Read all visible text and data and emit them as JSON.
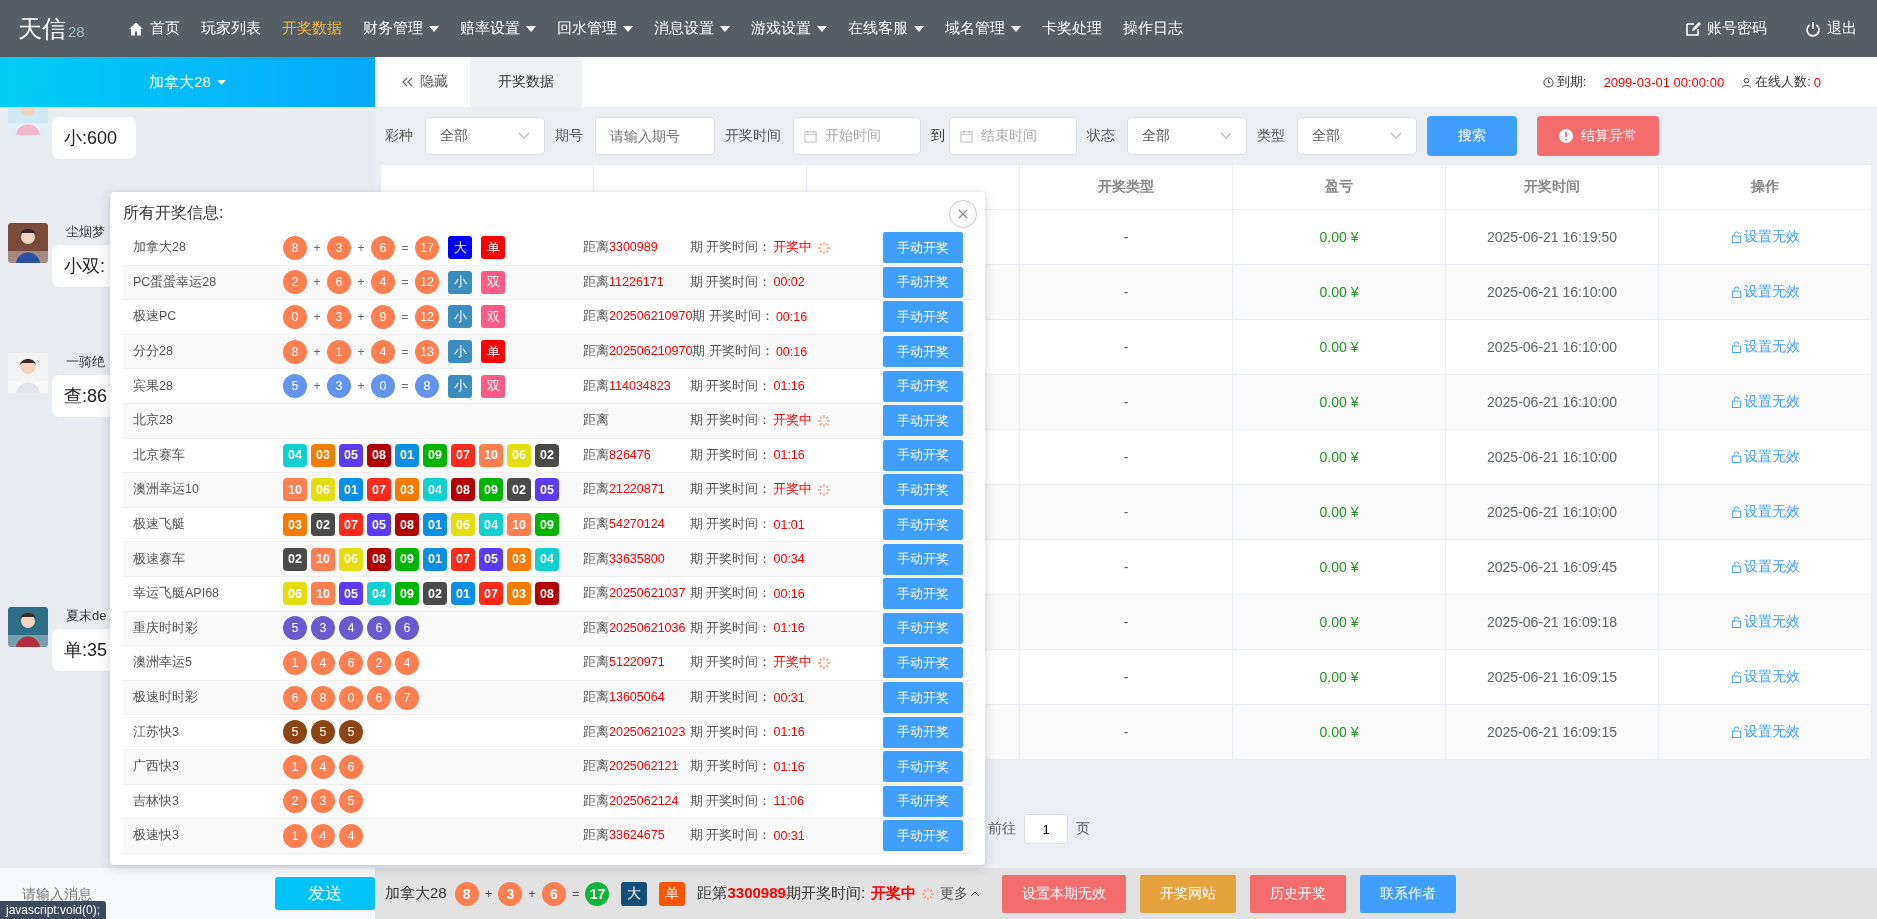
{
  "nav": {
    "logo": "天信",
    "logo_sub": "28",
    "items": [
      {
        "label": "首页",
        "selected": false,
        "dropdown": false
      },
      {
        "label": "玩家列表",
        "selected": false,
        "dropdown": false
      },
      {
        "label": "开奖数据",
        "selected": true,
        "dropdown": false
      },
      {
        "label": "财务管理",
        "selected": false,
        "dropdown": true
      },
      {
        "label": "赔率设置",
        "selected": false,
        "dropdown": true
      },
      {
        "label": "回水管理",
        "selected": false,
        "dropdown": true
      },
      {
        "label": "消息设置",
        "selected": false,
        "dropdown": true
      },
      {
        "label": "游戏设置",
        "selected": false,
        "dropdown": true
      },
      {
        "label": "在线客服",
        "selected": false,
        "dropdown": true
      },
      {
        "label": "域名管理",
        "selected": false,
        "dropdown": true
      },
      {
        "label": "卡奖处理",
        "selected": false,
        "dropdown": false
      },
      {
        "label": "操作日志",
        "selected": false,
        "dropdown": false
      }
    ],
    "account": "账号密码",
    "logout": "退出"
  },
  "lottery_switch": {
    "label": "加拿大28"
  },
  "tabs": {
    "hide": "隐藏",
    "items": [
      {
        "label": "开奖数据",
        "selected": true
      }
    ]
  },
  "expiry": {
    "label": "到期:",
    "value": "2099-03-01 00:00:00"
  },
  "online": {
    "label": "在线人数:",
    "value": "0"
  },
  "filters": [
    {
      "kind": "select",
      "label": "彩种",
      "value": "全部"
    },
    {
      "kind": "input",
      "label": "期号",
      "placeholder": "请输入期号"
    },
    {
      "kind": "daterange",
      "label": "开奖时间",
      "start_placeholder": "开始时间",
      "separator": "到",
      "end_placeholder": "结束时间"
    },
    {
      "kind": "select",
      "label": "状态",
      "value": "全部"
    },
    {
      "kind": "select",
      "label": "类型",
      "value": "全部"
    }
  ],
  "search_button": "搜索",
  "error_button": "结算异常",
  "table": {
    "visible_columns": [
      "开奖类型",
      "盈亏",
      "开奖时间",
      "操作"
    ],
    "rows": [
      {
        "type": "-",
        "profit": "0.00 ¥",
        "time": "2025-06-21 16:19:50",
        "action": "设置无效"
      },
      {
        "type": "-",
        "profit": "0.00 ¥",
        "time": "2025-06-21 16:10:00",
        "action": "设置无效"
      },
      {
        "type": "-",
        "profit": "0.00 ¥",
        "time": "2025-06-21 16:10:00",
        "action": "设置无效"
      },
      {
        "type": "-",
        "profit": "0.00 ¥",
        "time": "2025-06-21 16:10:00",
        "action": "设置无效"
      },
      {
        "type": "-",
        "profit": "0.00 ¥",
        "time": "2025-06-21 16:10:00",
        "action": "设置无效"
      },
      {
        "type": "-",
        "profit": "0.00 ¥",
        "time": "2025-06-21 16:10:00",
        "action": "设置无效"
      },
      {
        "type": "-",
        "profit": "0.00 ¥",
        "time": "2025-06-21 16:09:45",
        "action": "设置无效"
      },
      {
        "type": "-",
        "profit": "0.00 ¥",
        "time": "2025-06-21 16:09:18",
        "action": "设置无效"
      },
      {
        "type": "-",
        "profit": "0.00 ¥",
        "time": "2025-06-21 16:09:15",
        "action": "设置无效"
      },
      {
        "type": "-",
        "profit": "0.00 ¥",
        "time": "2025-06-21 16:09:15",
        "action": "设置无效"
      }
    ]
  },
  "pagination": {
    "goto": "前往",
    "page": "1",
    "unit": "页"
  },
  "chat": {
    "messages": [
      {
        "text": "小:600"
      },
      {
        "name": "尘烟梦",
        "text": "小双:"
      },
      {
        "name": "一骑绝",
        "text": "查:86"
      },
      {
        "name": "夏末de",
        "text": "单:35"
      }
    ],
    "input_placeholder": "请输入消息",
    "send": "发送"
  },
  "popup": {
    "title": "所有开奖信息:",
    "rows": [
      {
        "name": "加拿大28",
        "items": [
          {
            "kind": "ball",
            "text": "8",
            "color": "#ff7f50"
          },
          {
            "kind": "op",
            "text": "+"
          },
          {
            "kind": "ball",
            "text": "3",
            "color": "#ff7f50"
          },
          {
            "kind": "op",
            "text": "+"
          },
          {
            "kind": "ball",
            "text": "6",
            "color": "#ff7f50"
          },
          {
            "kind": "op",
            "text": "="
          },
          {
            "kind": "ball",
            "text": "17",
            "color": "#ff7f50"
          },
          {
            "kind": "tag",
            "text": "大",
            "color": "#0000ff"
          },
          {
            "kind": "tag",
            "text": "单",
            "color": "#ff0000"
          }
        ],
        "distance": "距离",
        "issue": "3300989",
        "time_label": "期 开奖时间：",
        "time": "开奖中",
        "spinner": true,
        "button": "手动开奖"
      },
      {
        "name": "PC蛋蛋幸运28",
        "items": [
          {
            "kind": "ball",
            "text": "2",
            "color": "#ff7f50"
          },
          {
            "kind": "op",
            "text": "+"
          },
          {
            "kind": "ball",
            "text": "6",
            "color": "#ff7f50"
          },
          {
            "kind": "op",
            "text": "+"
          },
          {
            "kind": "ball",
            "text": "4",
            "color": "#ff7f50"
          },
          {
            "kind": "op",
            "text": "="
          },
          {
            "kind": "ball",
            "text": "12",
            "color": "#ff7f50"
          },
          {
            "kind": "tag",
            "text": "小",
            "color": "#3b8dbd"
          },
          {
            "kind": "tag",
            "text": "双",
            "color": "#fd5a86"
          }
        ],
        "distance": "距离",
        "issue": "11226171",
        "time_label": "期 开奖时间：",
        "time": "00:02",
        "spinner": false,
        "button": "手动开奖"
      },
      {
        "name": "极速PC",
        "items": [
          {
            "kind": "ball",
            "text": "0",
            "color": "#ff7f50"
          },
          {
            "kind": "op",
            "text": "+"
          },
          {
            "kind": "ball",
            "text": "3",
            "color": "#ff7f50"
          },
          {
            "kind": "op",
            "text": "+"
          },
          {
            "kind": "ball",
            "text": "9",
            "color": "#ff7f50"
          },
          {
            "kind": "op",
            "text": "="
          },
          {
            "kind": "ball",
            "text": "12",
            "color": "#ff7f50"
          },
          {
            "kind": "tag",
            "text": "小",
            "color": "#3b8dbd"
          },
          {
            "kind": "tag",
            "text": "双",
            "color": "#fd5a86"
          }
        ],
        "distance": "距离",
        "issue": "202506210970",
        "time_label": "期 开奖时间：",
        "time": "00:16",
        "spinner": false,
        "button": "手动开奖"
      },
      {
        "name": "分分28",
        "items": [
          {
            "kind": "ball",
            "text": "8",
            "color": "#ff7f50"
          },
          {
            "kind": "op",
            "text": "+"
          },
          {
            "kind": "ball",
            "text": "1",
            "color": "#ff7f50"
          },
          {
            "kind": "op",
            "text": "+"
          },
          {
            "kind": "ball",
            "text": "4",
            "color": "#ff7f50"
          },
          {
            "kind": "op",
            "text": "="
          },
          {
            "kind": "ball",
            "text": "13",
            "color": "#ff7f50"
          },
          {
            "kind": "tag",
            "text": "小",
            "color": "#3b8dbd"
          },
          {
            "kind": "tag",
            "text": "单",
            "color": "#ff0000"
          }
        ],
        "distance": "距离",
        "issue": "202506210970",
        "time_label": "期 开奖时间：",
        "time": "00:16",
        "spinner": false,
        "button": "手动开奖"
      },
      {
        "name": "宾果28",
        "items": [
          {
            "kind": "ball",
            "text": "5",
            "color": "#6495ed"
          },
          {
            "kind": "op",
            "text": "+"
          },
          {
            "kind": "ball",
            "text": "3",
            "color": "#6495ed"
          },
          {
            "kind": "op",
            "text": "+"
          },
          {
            "kind": "ball",
            "text": "0",
            "color": "#6495ed"
          },
          {
            "kind": "op",
            "text": "="
          },
          {
            "kind": "ball",
            "text": "8",
            "color": "#6495ed"
          },
          {
            "kind": "tag",
            "text": "小",
            "color": "#3b8dbd"
          },
          {
            "kind": "tag",
            "text": "双",
            "color": "#fd5a86"
          }
        ],
        "distance": "距离",
        "issue": "114034823",
        "time_label": "期 开奖时间：",
        "time": "01:16",
        "spinner": false,
        "button": "手动开奖"
      },
      {
        "name": "北京28",
        "items": [],
        "distance": "距离",
        "time_label": "期 开奖时间：",
        "time": "开奖中",
        "spinner": true,
        "button": "手动开奖"
      },
      {
        "name": "北京赛车",
        "items": [
          {
            "kind": "square",
            "text": "04",
            "color": "#12cfd0"
          },
          {
            "kind": "square",
            "text": "03",
            "color": "#f57c00"
          },
          {
            "kind": "square",
            "text": "05",
            "color": "#5b3bf5"
          },
          {
            "kind": "square",
            "text": "08",
            "color": "#b30000"
          },
          {
            "kind": "square",
            "text": "01",
            "color": "#0b8fe3"
          },
          {
            "kind": "square",
            "text": "09",
            "color": "#00b400"
          },
          {
            "kind": "square",
            "text": "07",
            "color": "#ff2a1a"
          },
          {
            "kind": "square",
            "text": "10",
            "color": "#ff7f50"
          },
          {
            "kind": "square",
            "text": "06",
            "color": "#e4dd10"
          },
          {
            "kind": "square",
            "text": "02",
            "color": "#4a4a4a"
          }
        ],
        "distance": "距离",
        "issue": "826476",
        "time_label": "期 开奖时间：",
        "time": "01:16",
        "spinner": false,
        "button": "手动开奖"
      },
      {
        "name": "澳洲幸运10",
        "items": [
          {
            "kind": "square",
            "text": "10",
            "color": "#ff7f50"
          },
          {
            "kind": "square",
            "text": "06",
            "color": "#e4dd10"
          },
          {
            "kind": "square",
            "text": "01",
            "color": "#0b8fe3"
          },
          {
            "kind": "square",
            "text": "07",
            "color": "#ff2a1a"
          },
          {
            "kind": "square",
            "text": "03",
            "color": "#f57c00"
          },
          {
            "kind": "square",
            "text": "04",
            "color": "#12cfd0"
          },
          {
            "kind": "square",
            "text": "08",
            "color": "#b30000"
          },
          {
            "kind": "square",
            "text": "09",
            "color": "#00b400"
          },
          {
            "kind": "square",
            "text": "02",
            "color": "#4a4a4a"
          },
          {
            "kind": "square",
            "text": "05",
            "color": "#5b3bf5"
          }
        ],
        "distance": "距离",
        "issue": "21220871",
        "time_label": "期 开奖时间：",
        "time": "开奖中",
        "spinner": true,
        "button": "手动开奖"
      },
      {
        "name": "极速飞艇",
        "items": [
          {
            "kind": "square",
            "text": "03",
            "color": "#f57c00"
          },
          {
            "kind": "square",
            "text": "02",
            "color": "#4a4a4a"
          },
          {
            "kind": "square",
            "text": "07",
            "color": "#ff2a1a"
          },
          {
            "kind": "square",
            "text": "05",
            "color": "#5b3bf5"
          },
          {
            "kind": "square",
            "text": "08",
            "color": "#b30000"
          },
          {
            "kind": "square",
            "text": "01",
            "color": "#0b8fe3"
          },
          {
            "kind": "square",
            "text": "06",
            "color": "#e4dd10"
          },
          {
            "kind": "square",
            "text": "04",
            "color": "#12cfd0"
          },
          {
            "kind": "square",
            "text": "10",
            "color": "#ff7f50"
          },
          {
            "kind": "square",
            "text": "09",
            "color": "#00b400"
          }
        ],
        "distance": "距离",
        "issue": "54270124",
        "time_label": "期 开奖时间：",
        "time": "01:01",
        "spinner": false,
        "button": "手动开奖"
      },
      {
        "name": "极速赛车",
        "items": [
          {
            "kind": "square",
            "text": "02",
            "color": "#4a4a4a"
          },
          {
            "kind": "square",
            "text": "10",
            "color": "#ff7f50"
          },
          {
            "kind": "square",
            "text": "06",
            "color": "#e4dd10"
          },
          {
            "kind": "square",
            "text": "08",
            "color": "#b30000"
          },
          {
            "kind": "square",
            "text": "09",
            "color": "#00b400"
          },
          {
            "kind": "square",
            "text": "01",
            "color": "#0b8fe3"
          },
          {
            "kind": "square",
            "text": "07",
            "color": "#ff2a1a"
          },
          {
            "kind": "square",
            "text": "05",
            "color": "#5b3bf5"
          },
          {
            "kind": "square",
            "text": "03",
            "color": "#f57c00"
          },
          {
            "kind": "square",
            "text": "04",
            "color": "#12cfd0"
          }
        ],
        "distance": "距离",
        "issue": "33635800",
        "time_label": "期 开奖时间：",
        "time": "00:34",
        "spinner": false,
        "button": "手动开奖"
      },
      {
        "name": "幸运飞艇API68",
        "items": [
          {
            "kind": "square",
            "text": "06",
            "color": "#e4dd10"
          },
          {
            "kind": "square",
            "text": "10",
            "color": "#ff7f50"
          },
          {
            "kind": "square",
            "text": "05",
            "color": "#5b3bf5"
          },
          {
            "kind": "square",
            "text": "04",
            "color": "#12cfd0"
          },
          {
            "kind": "square",
            "text": "09",
            "color": "#00b400"
          },
          {
            "kind": "square",
            "text": "02",
            "color": "#4a4a4a"
          },
          {
            "kind": "square",
            "text": "01",
            "color": "#0b8fe3"
          },
          {
            "kind": "square",
            "text": "07",
            "color": "#ff2a1a"
          },
          {
            "kind": "square",
            "text": "03",
            "color": "#f57c00"
          },
          {
            "kind": "square",
            "text": "08",
            "color": "#b30000"
          }
        ],
        "distance": "距离",
        "issue": "20250621037",
        "time_label": "期 开奖时间：",
        "time": "00:16",
        "spinner": false,
        "button": "手动开奖"
      },
      {
        "name": "重庆时时彩",
        "items": [
          {
            "kind": "ball",
            "text": "5",
            "color": "#6a5acd"
          },
          {
            "kind": "ball",
            "text": "3",
            "color": "#6a5acd"
          },
          {
            "kind": "ball",
            "text": "4",
            "color": "#6a5acd"
          },
          {
            "kind": "ball",
            "text": "6",
            "color": "#6a5acd"
          },
          {
            "kind": "ball",
            "text": "6",
            "color": "#6a5acd"
          }
        ],
        "distance": "距离",
        "issue": "20250621036",
        "time_label": "期 开奖时间：",
        "time": "01:16",
        "spinner": false,
        "button": "手动开奖"
      },
      {
        "name": "澳洲幸运5",
        "items": [
          {
            "kind": "ball",
            "text": "1",
            "color": "#ff7f50"
          },
          {
            "kind": "ball",
            "text": "4",
            "color": "#ff7f50"
          },
          {
            "kind": "ball",
            "text": "6",
            "color": "#ff7f50"
          },
          {
            "kind": "ball",
            "text": "2",
            "color": "#ff7f50"
          },
          {
            "kind": "ball",
            "text": "4",
            "color": "#ff7f50"
          }
        ],
        "distance": "距离",
        "issue": "51220971",
        "time_label": "期 开奖时间：",
        "time": "开奖中",
        "spinner": true,
        "button": "手动开奖"
      },
      {
        "name": "极速时时彩",
        "items": [
          {
            "kind": "ball",
            "text": "6",
            "color": "#ff7f50"
          },
          {
            "kind": "ball",
            "text": "8",
            "color": "#ff7f50"
          },
          {
            "kind": "ball",
            "text": "0",
            "color": "#ff7f50"
          },
          {
            "kind": "ball",
            "text": "6",
            "color": "#ff7f50"
          },
          {
            "kind": "ball",
            "text": "7",
            "color": "#ff7f50"
          }
        ],
        "distance": "距离",
        "issue": "13605064",
        "time_label": "期 开奖时间：",
        "time": "00:31",
        "spinner": false,
        "button": "手动开奖"
      },
      {
        "name": "江苏快3",
        "items": [
          {
            "kind": "ball",
            "text": "5",
            "color": "#8b4513"
          },
          {
            "kind": "ball",
            "text": "5",
            "color": "#8b4513"
          },
          {
            "kind": "ball",
            "text": "5",
            "color": "#8b4513"
          }
        ],
        "distance": "距离",
        "issue": "20250621023",
        "time_label": "期 开奖时间：",
        "time": "01:16",
        "spinner": false,
        "button": "手动开奖"
      },
      {
        "name": "广西快3",
        "items": [
          {
            "kind": "ball",
            "text": "1",
            "color": "#ff7f50"
          },
          {
            "kind": "ball",
            "text": "4",
            "color": "#ff7f50"
          },
          {
            "kind": "ball",
            "text": "6",
            "color": "#ff7f50"
          }
        ],
        "distance": "距离",
        "issue": "2025062121",
        "time_label": "期 开奖时间：",
        "time": "01:16",
        "spinner": false,
        "button": "手动开奖"
      },
      {
        "name": "吉林快3",
        "items": [
          {
            "kind": "ball",
            "text": "2",
            "color": "#ff7f50"
          },
          {
            "kind": "ball",
            "text": "3",
            "color": "#ff7f50"
          },
          {
            "kind": "ball",
            "text": "5",
            "color": "#ff7f50"
          }
        ],
        "distance": "距离",
        "issue": "2025062124",
        "time_label": "期 开奖时间：",
        "time": "11:06",
        "spinner": false,
        "button": "手动开奖"
      },
      {
        "name": "极速快3",
        "items": [
          {
            "kind": "ball",
            "text": "1",
            "color": "#ff7f50"
          },
          {
            "kind": "ball",
            "text": "4",
            "color": "#ff7f50"
          },
          {
            "kind": "ball",
            "text": "4",
            "color": "#ff7f50"
          }
        ],
        "distance": "距离",
        "issue": "33624675",
        "time_label": "期 开奖时间：",
        "time": "00:31",
        "spinner": false,
        "button": "手动开奖"
      }
    ]
  },
  "ticker": {
    "name": "加拿大28",
    "items": [
      {
        "kind": "ball",
        "text": "8",
        "color": "#ff7f50"
      },
      {
        "kind": "op",
        "text": "+"
      },
      {
        "kind": "ball",
        "text": "3",
        "color": "#ff7f50"
      },
      {
        "kind": "op",
        "text": "+"
      },
      {
        "kind": "ball",
        "text": "6",
        "color": "#ff7f50"
      },
      {
        "kind": "op",
        "text": "="
      },
      {
        "kind": "ball",
        "text": "17",
        "color": "#11b33c"
      },
      {
        "kind": "tag",
        "text": "大",
        "color": "#124e78"
      },
      {
        "kind": "tag",
        "text": "单",
        "color": "#ff5500"
      }
    ],
    "prefix": "距第",
    "issue": "3300989",
    "suffix": "期开奖时间:",
    "status": "开奖中",
    "spinner": true,
    "more": "更多"
  },
  "actions": [
    {
      "label": "设置本期无效",
      "color": "#f56c6c"
    },
    {
      "label": "开奖网站",
      "color": "#e6a23c"
    },
    {
      "label": "历史开奖",
      "color": "#f56c6c"
    },
    {
      "label": "联系作者",
      "color": "#409eff"
    }
  ],
  "status_tooltip": "javascript:void(0);"
}
